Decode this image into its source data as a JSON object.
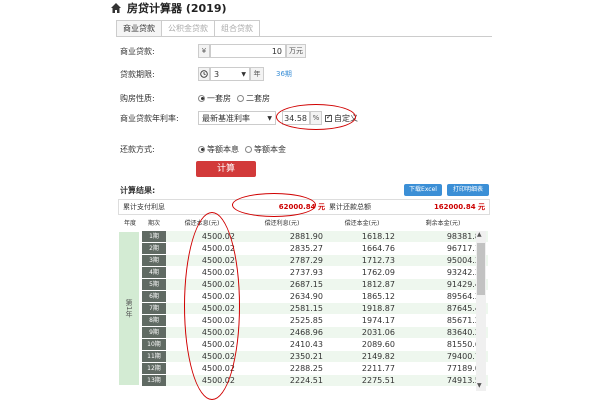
{
  "header": {
    "title": "房贷计算器 (2019)",
    "icon": "home-icon"
  },
  "tabs": [
    {
      "label": "商业贷款",
      "active": true
    },
    {
      "label": "公积金贷款",
      "active": false
    },
    {
      "label": "组合贷款",
      "active": false
    }
  ],
  "form": {
    "loan_amount": {
      "label": "商业贷款:",
      "prefix": "¥",
      "value": "10",
      "unit": "万元"
    },
    "loan_term": {
      "label": "贷款期限:",
      "value": "3",
      "unit": "年",
      "periods": "36期"
    },
    "property": {
      "label": "购房性质:",
      "options": [
        "一套房",
        "二套房"
      ],
      "selected": 0
    },
    "rate": {
      "label": "商业贷款年利率:",
      "select_value": "最新基准利率",
      "value": "34.58",
      "unit": "%",
      "custom_label": "自定义",
      "custom_checked": true
    },
    "repay_method": {
      "label": "还款方式:",
      "options": [
        "等额本息",
        "等额本金"
      ],
      "selected": 0
    },
    "calc_button": "计算"
  },
  "result": {
    "title": "计算结果:",
    "export_button": "下载Excel",
    "print_button": "打印明细表",
    "total_interest_label": "累计支付利息",
    "total_interest_value": "62000.84 元",
    "total_payment_label": "累计还款总额",
    "total_payment_value": "162000.84 元"
  },
  "table": {
    "headers": [
      "年度",
      "期次",
      "偿还本息(元)",
      "偿还利息(元)",
      "偿还本金(元)",
      "剩余本金(元)"
    ],
    "year_label": "第1年",
    "rows": [
      {
        "period": "1期",
        "payment": "4500.02",
        "interest": "2881.90",
        "principal": "1618.12",
        "remaining": "98381.88"
      },
      {
        "period": "2期",
        "payment": "4500.02",
        "interest": "2835.27",
        "principal": "1664.76",
        "remaining": "96717.12"
      },
      {
        "period": "3期",
        "payment": "4500.02",
        "interest": "2787.29",
        "principal": "1712.73",
        "remaining": "95004.39"
      },
      {
        "period": "4期",
        "payment": "4500.02",
        "interest": "2737.93",
        "principal": "1762.09",
        "remaining": "93242.30"
      },
      {
        "period": "5期",
        "payment": "4500.02",
        "interest": "2687.15",
        "principal": "1812.87",
        "remaining": "91429.42"
      },
      {
        "period": "6期",
        "payment": "4500.02",
        "interest": "2634.90",
        "principal": "1865.12",
        "remaining": "89564.30"
      },
      {
        "period": "7期",
        "payment": "4500.02",
        "interest": "2581.15",
        "principal": "1918.87",
        "remaining": "87645.43"
      },
      {
        "period": "8期",
        "payment": "4500.02",
        "interest": "2525.85",
        "principal": "1974.17",
        "remaining": "85671.26"
      },
      {
        "period": "9期",
        "payment": "4500.02",
        "interest": "2468.96",
        "principal": "2031.06",
        "remaining": "83640.20"
      },
      {
        "period": "10期",
        "payment": "4500.02",
        "interest": "2410.43",
        "principal": "2089.60",
        "remaining": "81550.60"
      },
      {
        "period": "11期",
        "payment": "4500.02",
        "interest": "2350.21",
        "principal": "2149.82",
        "remaining": "79400.79"
      },
      {
        "period": "12期",
        "payment": "4500.02",
        "interest": "2288.25",
        "principal": "2211.77",
        "remaining": "77189.02"
      },
      {
        "period": "13期",
        "payment": "4500.02",
        "interest": "2224.51",
        "principal": "2275.51",
        "remaining": "74913.50"
      }
    ]
  },
  "colors": {
    "accent_red": "#d23a3a",
    "button_blue": "#3b8fd6",
    "annotation_red": "#d00000"
  }
}
